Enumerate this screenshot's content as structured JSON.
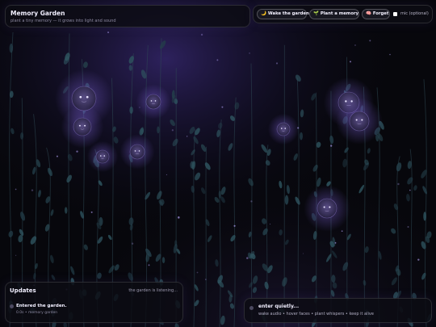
{
  "header": {
    "title": "Memory Garden",
    "subtitle": "plant a tiny memory — it grows into light and sound"
  },
  "toolbar": {
    "wake": {
      "icon": "moon-icon",
      "glyph": "🌙",
      "label": "Wake the garden"
    },
    "plant": {
      "icon": "seedling-icon",
      "glyph": "🌱",
      "label": "Plant a memory"
    },
    "forget": {
      "icon": "brain-icon",
      "glyph": "🧠",
      "label": "Forget"
    },
    "mic_label": "mic (optional)",
    "mic_checked": false
  },
  "updates": {
    "title": "Updates",
    "status": "the garden is listening...",
    "items": [
      {
        "title": "Entered the garden.",
        "meta": "0.0s • memory garden"
      }
    ]
  },
  "hint": {
    "title": "enter quietly...",
    "subtitle": "wake audio • hover faces • plant whispers • keep it alive"
  },
  "colors": {
    "background": "#07070c",
    "glow": "#6f55c8",
    "vine": "#2f4a55"
  }
}
